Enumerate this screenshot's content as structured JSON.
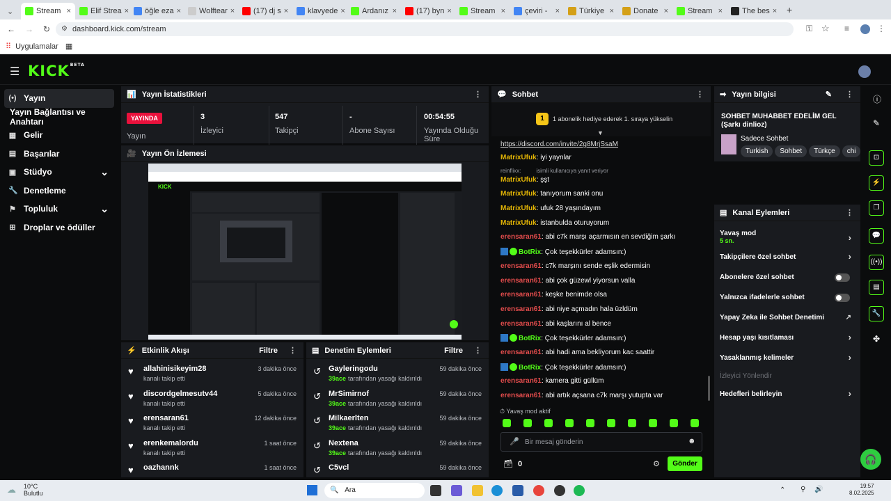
{
  "browser": {
    "tabs": [
      {
        "label": "Stream",
        "color": "#53fc18",
        "active": true
      },
      {
        "label": "Elif Strea",
        "color": "#53fc18"
      },
      {
        "label": "öğle eza",
        "color": "#4285f4"
      },
      {
        "label": "Wolftear",
        "color": "#cccccc"
      },
      {
        "label": "(17) dj s",
        "color": "#ff0000"
      },
      {
        "label": "klavyede",
        "color": "#4285f4"
      },
      {
        "label": "Ardanız",
        "color": "#53fc18"
      },
      {
        "label": "(17) byn",
        "color": "#ff0000"
      },
      {
        "label": "Stream",
        "color": "#53fc18"
      },
      {
        "label": "çeviri -",
        "color": "#4285f4"
      },
      {
        "label": "Türkiye",
        "color": "#d4a017"
      },
      {
        "label": "Donate",
        "color": "#d4a017"
      },
      {
        "label": "Stream",
        "color": "#53fc18"
      },
      {
        "label": "The bes",
        "color": "#222222"
      }
    ],
    "url": "dashboard.kick.com/stream",
    "bookmarks_label": "Uygulamalar"
  },
  "sidebar": {
    "items": [
      {
        "label": "Yayın",
        "icon": "(•)",
        "active": true
      },
      {
        "label": "Yayın Bağlantısı ve Anahtarı",
        "icon": ""
      },
      {
        "label": "Gelir",
        "icon": "▦"
      },
      {
        "label": "Başarılar",
        "icon": "▤"
      },
      {
        "label": "Stüdyo",
        "icon": "▣",
        "chevron": true
      },
      {
        "label": "Denetleme",
        "icon": "🔧"
      },
      {
        "label": "Topluluk",
        "icon": "⚑",
        "chevron": true
      },
      {
        "label": "Droplar ve ödüller",
        "icon": "⊞"
      }
    ]
  },
  "stats": {
    "title": "Yayın İstatistikleri",
    "live_badge": "YAYINDA",
    "live_label": "Yayın",
    "viewers": {
      "value": "3",
      "label": "İzleyici"
    },
    "followers": {
      "value": "547",
      "label": "Takipçi"
    },
    "subs": {
      "value": "-",
      "label": "Abone Sayısı"
    },
    "uptime": {
      "value": "00:54:55",
      "label": "Yayında Olduğu Süre"
    }
  },
  "preview": {
    "title": "Yayın Ön İzlemesi"
  },
  "activity": {
    "title": "Etkinlik Akışı",
    "filter": "Filtre",
    "rows": [
      {
        "name": "allahinisikeyim28",
        "sub": "kanalı takip etti",
        "time": "3 dakika önce"
      },
      {
        "name": "discordgelmesutv44",
        "sub": "kanalı takip etti",
        "time": "5 dakika önce"
      },
      {
        "name": "erensaran61",
        "sub": "kanalı takip etti",
        "time": "12 dakika önce"
      },
      {
        "name": "erenkemalordu",
        "sub": "kanalı takip etti",
        "time": "1 saat önce"
      },
      {
        "name": "oazhannk",
        "sub": "",
        "time": "1 saat önce"
      }
    ]
  },
  "moderation": {
    "title": "Denetim Eylemleri",
    "filter": "Filtre",
    "rows": [
      {
        "name": "Gayleringodu",
        "mod": "39ace",
        "sub": "tarafından yasağı kaldırıldı",
        "time": "59 dakika önce"
      },
      {
        "name": "MrSimirnof",
        "mod": "39ace",
        "sub": "tarafından yasağı kaldırıldı",
        "time": "59 dakika önce"
      },
      {
        "name": "Milkaerlten",
        "mod": "39ace",
        "sub": "tarafından yasağı kaldırıldı",
        "time": "59 dakika önce"
      },
      {
        "name": "Nextena",
        "mod": "39ace",
        "sub": "tarafından yasağı kaldırıldı",
        "time": "59 dakika önce"
      },
      {
        "name": "C5vcl",
        "mod": "",
        "sub": "",
        "time": "59 dakika önce"
      }
    ]
  },
  "chat": {
    "title": "Sohbet",
    "pinned": "1 abonelik hediye ederek 1. sıraya yükselin",
    "pinned_rank": "1",
    "link": "https://discord.com/invite/2g8MrjSsaM",
    "messages": [
      {
        "user": "MatrixUfuk",
        "type": "mat",
        "text": ": iyi yaynlar"
      },
      {
        "user": "reinflixx:",
        "type": "reply",
        "text": "isimli kullanıcıya yanıt veriyor"
      },
      {
        "user": "MatrixUfuk",
        "type": "mat",
        "text": ": şşt"
      },
      {
        "user": "MatrixUfuk",
        "type": "mat",
        "text": ": tanıyorum sanki onu"
      },
      {
        "user": "MatrixUfuk",
        "type": "mat",
        "text": ": ufuk 28 yaşındayım"
      },
      {
        "user": "MatrixUfuk",
        "type": "mat",
        "text": ": istanbulda oturuyorum"
      },
      {
        "user": "erensaran61",
        "type": "ere",
        "text": ": abi c7k marşı açarmısın en sevdiğim şarkı"
      },
      {
        "user": "BotRix",
        "type": "bot",
        "text": ": Çok teşekkürler adamsın:)"
      },
      {
        "user": "erensaran61",
        "type": "ere",
        "text": ": c7k marşını sende eşlik edermisin"
      },
      {
        "user": "erensaran61",
        "type": "ere",
        "text": ": abi çok güzewl yiyorsun valla"
      },
      {
        "user": "erensaran61",
        "type": "ere",
        "text": ": keşke benimde olsa"
      },
      {
        "user": "erensaran61",
        "type": "ere",
        "text": ": abi niye açmadın hala üzldüm"
      },
      {
        "user": "erensaran61",
        "type": "ere",
        "text": ": abi kaşlarını al bence"
      },
      {
        "user": "BotRix",
        "type": "bot",
        "text": ": Çok teşekkürler adamsın:)"
      },
      {
        "user": "erensaran61",
        "type": "ere",
        "text": ": abi hadi ama bekliyorum kac saattir"
      },
      {
        "user": "BotRix",
        "type": "bot",
        "text": ": Çok teşekkürler adamsın:)"
      },
      {
        "user": "erensaran61",
        "type": "ere",
        "text": ": kamera gitti güllüm"
      },
      {
        "user": "erensaran61",
        "type": "ere",
        "text": ": abi artık açsana c7k marşı yutupta var"
      }
    ],
    "slow_mode": "Yavaş mod aktif",
    "input_placeholder": "Bir mesaj gönderin",
    "points": "0",
    "send": "Gönder"
  },
  "info": {
    "title": "Yayın bilgisi",
    "stream_title": "SOHBET MUHABBET EDELİM GEL (Şarkı dinlioz)",
    "category": "Sadece Sohbet",
    "tags": [
      "Turkish",
      "Sohbet",
      "Türkçe",
      "chi"
    ]
  },
  "channel_actions": {
    "title": "Kanal Eylemleri",
    "slow_mode": {
      "label": "Yavaş mod",
      "value": "5 sn."
    },
    "items": [
      {
        "label": "Takipçilere özel sohbet",
        "control": "chevron"
      },
      {
        "label": "Abonelere özel sohbet",
        "control": "toggle"
      },
      {
        "label": "Yalnızca ifadelerle sohbet",
        "control": "toggle"
      },
      {
        "label": "Yapay Zeka ile Sohbet Denetimi",
        "control": "external"
      },
      {
        "label": "Hesap yaşı kısıtlaması",
        "control": "chevron"
      },
      {
        "label": "Yasaklanmış kelimeler",
        "control": "chevron"
      },
      {
        "label": "İzleyici Yönlendir",
        "control": "none",
        "disabled": true
      },
      {
        "label": "Hedefleri belirleyin",
        "control": "chevron"
      }
    ]
  },
  "taskbar": {
    "weather_temp": "10°C",
    "weather_desc": "Bulutlu",
    "search": "Ara",
    "time": "19:57",
    "date": "8.02.2025"
  },
  "colors": {
    "accent": "#53fc18",
    "live": "#e9113c",
    "panel": "#191b1f",
    "bg": "#0b0c0d"
  }
}
